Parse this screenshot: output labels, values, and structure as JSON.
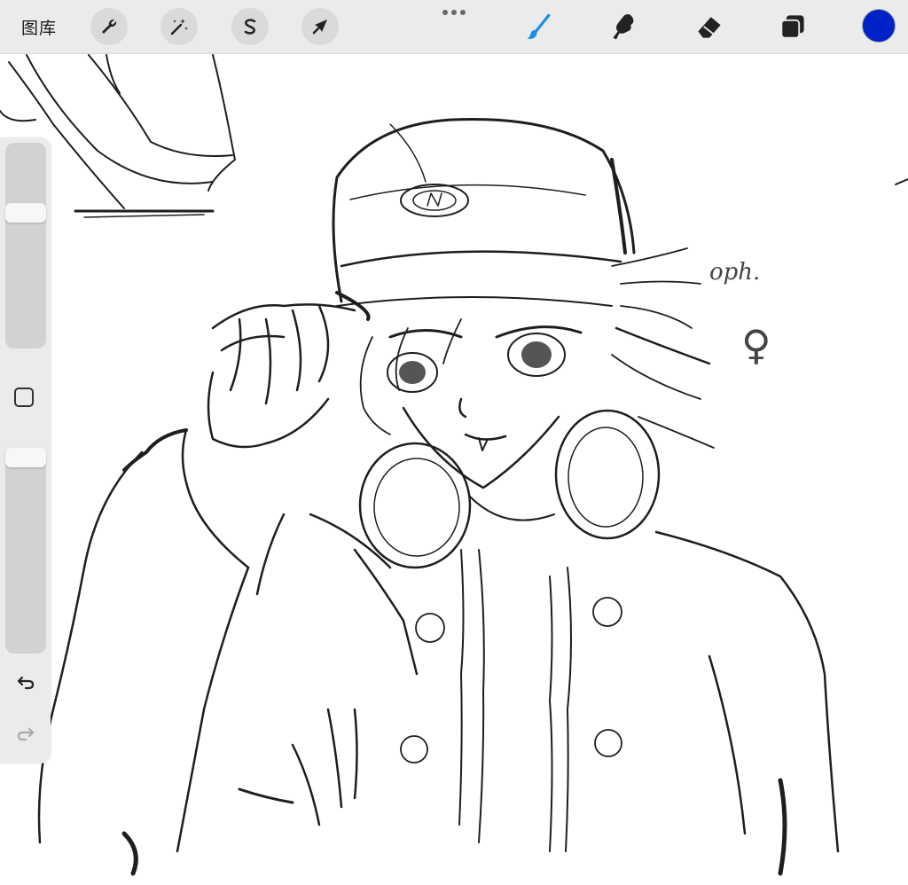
{
  "toolbar": {
    "gallery_label": "图库",
    "actions_tool": "wrench-icon",
    "adjustments_tool": "magic-wand-icon",
    "selection_tool": "selection-s-icon",
    "transform_tool": "arrow-cursor-icon",
    "more_menu": "ellipsis-icon",
    "brush_tool": "brush-icon",
    "smudge_tool": "smudge-finger-icon",
    "eraser_tool": "eraser-icon",
    "layers_tool": "layers-icon",
    "current_color": "#0022c7",
    "active_tool_color": "#1b8fe3"
  },
  "sidebar": {
    "brush_size_slider": 0.08,
    "opacity_slider": 0.0,
    "undo_icon": "undo-icon",
    "redo_icon": "redo-icon"
  },
  "canvas": {
    "sketch_note": "oph.",
    "symbol": "♀"
  }
}
